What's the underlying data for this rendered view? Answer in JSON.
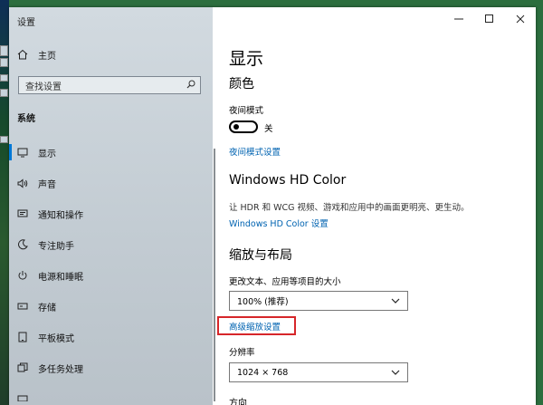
{
  "window": {
    "title": "设置"
  },
  "sidebar": {
    "home": "主页",
    "search_placeholder": "查找设置",
    "section": "系统",
    "items": [
      {
        "label": "显示",
        "icon": "monitor-icon",
        "active": true
      },
      {
        "label": "声音",
        "icon": "speaker-icon"
      },
      {
        "label": "通知和操作",
        "icon": "notification-icon"
      },
      {
        "label": "专注助手",
        "icon": "moon-icon"
      },
      {
        "label": "电源和睡眠",
        "icon": "power-icon"
      },
      {
        "label": "存储",
        "icon": "storage-icon"
      },
      {
        "label": "平板模式",
        "icon": "tablet-icon"
      },
      {
        "label": "多任务处理",
        "icon": "multitask-icon"
      }
    ]
  },
  "content": {
    "title": "显示",
    "color": {
      "heading": "颜色",
      "night_light_label": "夜间模式",
      "night_light_state": "关",
      "night_light_link": "夜间模式设置"
    },
    "hdr": {
      "heading": "Windows HD Color",
      "description": "让 HDR 和 WCG 视频、游戏和应用中的画面更明亮、更生动。",
      "link": "Windows HD Color 设置"
    },
    "scale": {
      "heading": "缩放与布局",
      "size_label": "更改文本、应用等项目的大小",
      "size_value": "100% (推荐)",
      "advanced_link": "高级缩放设置",
      "resolution_label": "分辨率",
      "resolution_value": "1024 × 768",
      "next_heading_partial": "方向"
    }
  }
}
